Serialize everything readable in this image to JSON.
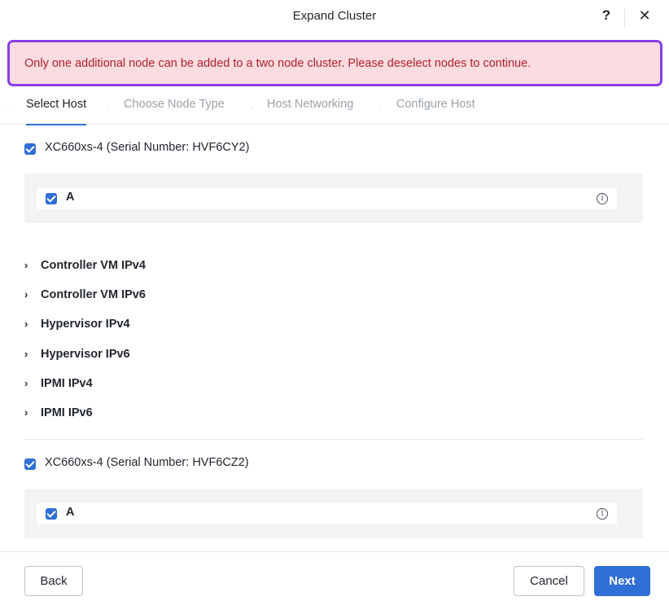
{
  "dialog": {
    "title": "Expand Cluster",
    "help_label": "?",
    "close_label": "✕"
  },
  "alert": {
    "message": "Only one additional node can be added to a two node cluster. Please deselect nodes to continue."
  },
  "steps": [
    {
      "label": "Select Host",
      "active": true
    },
    {
      "label": "Choose Node Type",
      "active": false
    },
    {
      "label": "Host Networking",
      "active": false
    },
    {
      "label": "Configure Host",
      "active": false
    }
  ],
  "step_separator": "·",
  "hosts": [
    {
      "label": "XC660xs-4 (Serial Number: HVF6CY2)",
      "checked": true,
      "node": {
        "label": "A",
        "checked": true,
        "info_glyph": "i"
      }
    },
    {
      "label": "XC660xs-4 (Serial Number: HVF6CZ2)",
      "checked": true,
      "node": {
        "label": "A",
        "checked": true,
        "info_glyph": "i"
      }
    }
  ],
  "sections": [
    {
      "label": "Controller VM IPv4",
      "icon": "chevron-right-icon"
    },
    {
      "label": "Controller VM IPv6",
      "icon": "chevron-right-icon"
    },
    {
      "label": "Hypervisor IPv4",
      "icon": "chevron-right-icon"
    },
    {
      "label": "Hypervisor IPv6",
      "icon": "chevron-right-icon"
    },
    {
      "label": "IPMI IPv4",
      "icon": "chevron-right-icon"
    },
    {
      "label": "IPMI IPv6",
      "icon": "chevron-right-icon"
    }
  ],
  "chevron_glyph": "›",
  "footer": {
    "back_label": "Back",
    "cancel_label": "Cancel",
    "next_label": "Next"
  },
  "colors": {
    "primary": "#2f6fd6",
    "alert_bg": "#fbdde1",
    "alert_text": "#b3202f",
    "alert_border": "#8a3ee6"
  }
}
